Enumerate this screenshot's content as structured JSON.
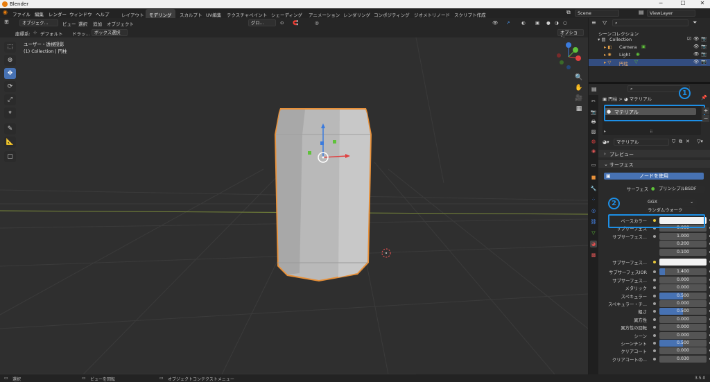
{
  "app": {
    "title": "Blender",
    "window": {
      "minimize": "─",
      "maximize": "☐",
      "close": "✕"
    }
  },
  "menus": [
    "ファイル",
    "編集",
    "レンダー",
    "ウィンドウ",
    "ヘルプ"
  ],
  "workspaces": [
    {
      "label": "レイアウト",
      "active": false
    },
    {
      "label": "モデリング",
      "active": true
    },
    {
      "label": "スカルプト",
      "active": false
    },
    {
      "label": "UV編集",
      "active": false
    },
    {
      "label": "テクスチャペイント",
      "active": false
    },
    {
      "label": "シェーディング",
      "active": false
    },
    {
      "label": "アニメーション",
      "active": false
    },
    {
      "label": "レンダリング",
      "active": false
    },
    {
      "label": "コンポジティング",
      "active": false
    },
    {
      "label": "ジオメトリノード",
      "active": false
    },
    {
      "label": "スクリプト作成",
      "active": false
    }
  ],
  "scene": {
    "scene_name": "Scene",
    "view_layer": "ViewLayer"
  },
  "viewport_header": {
    "mode": "オブジェク...",
    "menus": [
      "ビュー",
      "選択",
      "追加",
      "オブジェクト"
    ],
    "transform": "グロ...",
    "options": "オプション"
  },
  "viewport_header2": {
    "coord_label": "座標系:",
    "coord_value": "デフォルト",
    "drag_label": "ドラッ...",
    "select_mode": "ボックス選択"
  },
  "viewport_overlay": {
    "line1": "ユーザー・透視投影",
    "line2": "(1) Collection | 円柱"
  },
  "gizmo": {
    "x": "X",
    "y": "Y",
    "z": "Z"
  },
  "colors": {
    "accent": "#4772b3",
    "highlight": "#1d8fe6",
    "selection_outline": "#e8913a"
  },
  "outliner": {
    "title": "シーンコレクション",
    "items": [
      {
        "label": "Collection",
        "icon": "collection-icon",
        "selected": false
      },
      {
        "label": "Camera",
        "icon": "camera-icon",
        "selected": false
      },
      {
        "label": "Light",
        "icon": "light-icon",
        "selected": false
      },
      {
        "label": "円柱",
        "icon": "mesh-icon",
        "selected": true
      }
    ]
  },
  "properties": {
    "breadcrumb_object": "円柱",
    "breadcrumb_material": "マテリアル",
    "slot": "マテリアル",
    "material_name": "マテリアル",
    "section_preview": "プレビュー",
    "section_surface": "サーフェス",
    "use_nodes": "ノードを使用",
    "surface_label": "サーフェス",
    "surface_value": "プリンシプルBSDF",
    "distribution": "GGX",
    "subsurface_method": "ランダムウォーク",
    "rows": [
      {
        "label": "ベースカラー",
        "value": "",
        "type": "color"
      },
      {
        "label": "サブサーフェス",
        "value": "0.000",
        "type": "num"
      },
      {
        "label": "サブサーフェス...",
        "value": "1.000",
        "type": "num"
      },
      {
        "label": "",
        "value": "0.200",
        "type": "num"
      },
      {
        "label": "",
        "value": "0.100",
        "type": "num"
      },
      {
        "label": "サブサーフェス...",
        "value": "",
        "type": "color"
      },
      {
        "label": "サブサーフェスIOR",
        "value": "1.400",
        "type": "num",
        "fill": 0.12
      },
      {
        "label": "サブサーフェス...",
        "value": "0.000",
        "type": "num"
      },
      {
        "label": "メタリック",
        "value": "0.000",
        "type": "num"
      },
      {
        "label": "スペキュラー",
        "value": "0.500",
        "type": "num",
        "fill": 0.5
      },
      {
        "label": "スペキュラー・チ...",
        "value": "0.000",
        "type": "num"
      },
      {
        "label": "粗さ",
        "value": "0.500",
        "type": "num",
        "fill": 0.5
      },
      {
        "label": "異方性",
        "value": "0.000",
        "type": "num"
      },
      {
        "label": "異方性の回転",
        "value": "0.000",
        "type": "num"
      },
      {
        "label": "シーン",
        "value": "0.000",
        "type": "num"
      },
      {
        "label": "シーンチント",
        "value": "0.500",
        "type": "num",
        "fill": 0.5
      },
      {
        "label": "クリアコート",
        "value": "0.000",
        "type": "num"
      },
      {
        "label": "クリアコートの...",
        "value": "0.030",
        "type": "num"
      }
    ]
  },
  "annotations": {
    "one": "1",
    "two": "2"
  },
  "status": {
    "select": "選択",
    "rotate": "ビューを回転",
    "context": "オブジェクトコンテクストメニュー",
    "version": "3.5.0"
  }
}
